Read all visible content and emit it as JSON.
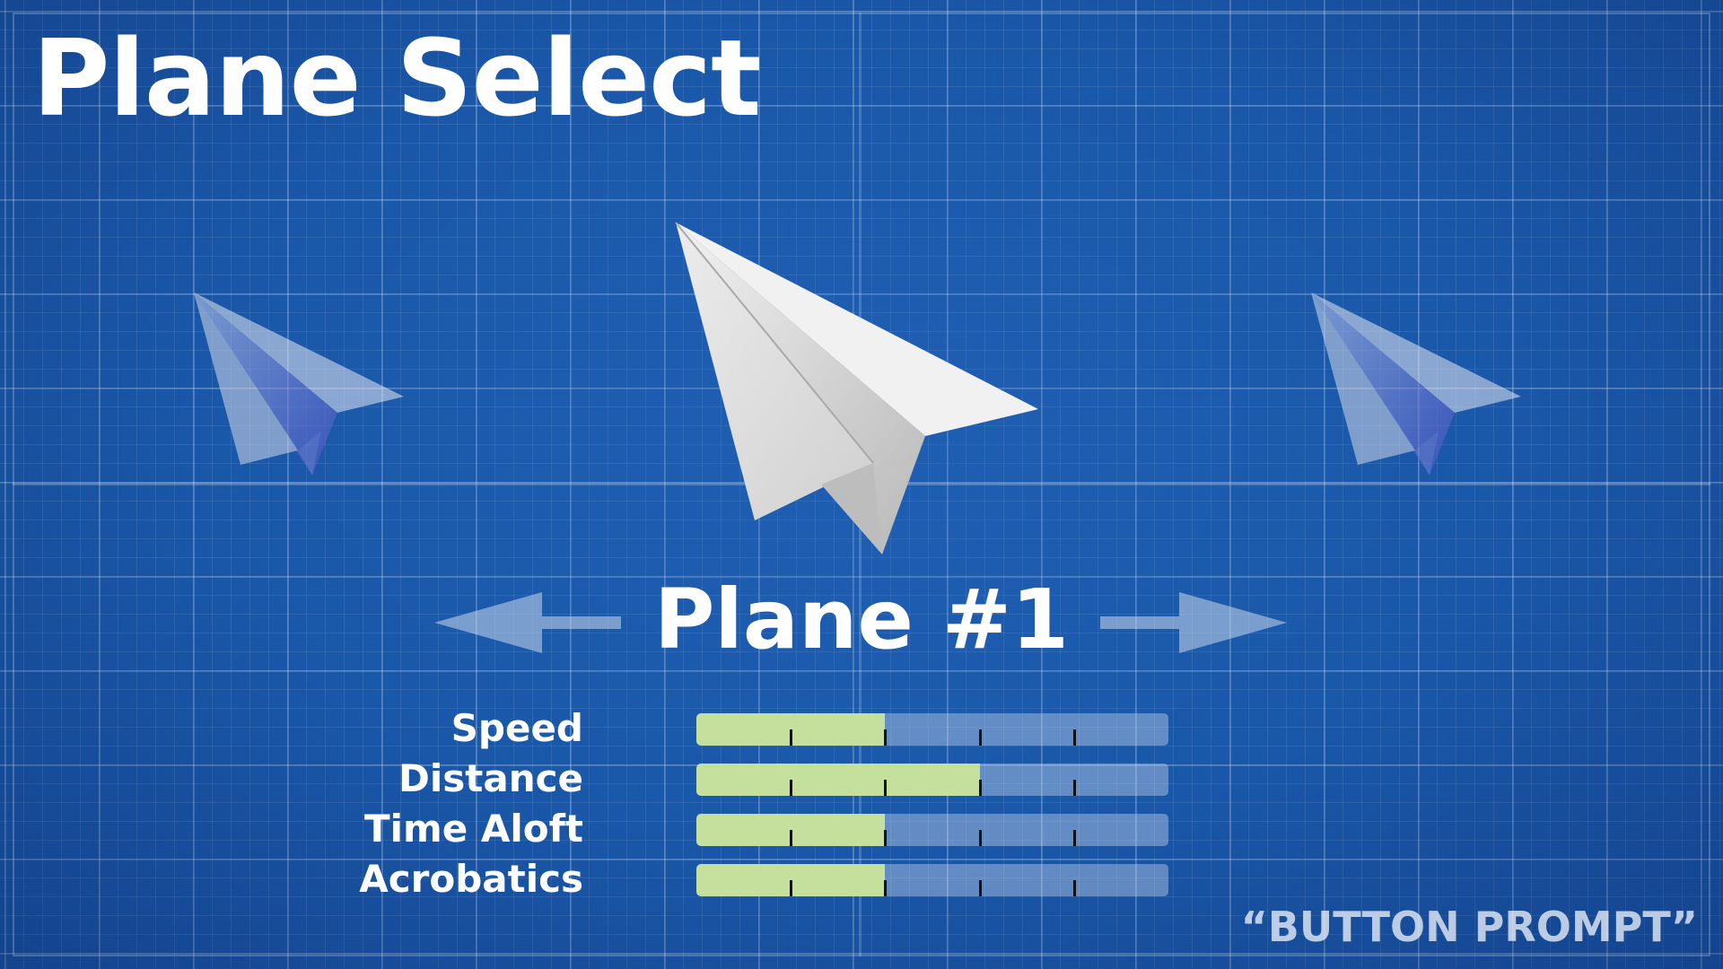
{
  "screen": {
    "title": "Plane Select",
    "background_color": "#1a57a8",
    "grid_color": "#ffffff"
  },
  "carousel": {
    "left_arrow_icon": "arrow-left-icon",
    "right_arrow_icon": "arrow-right-icon",
    "planes": [
      {
        "slot": "previous",
        "icon": "paper-plane-icon"
      },
      {
        "slot": "selected",
        "icon": "paper-plane-icon"
      },
      {
        "slot": "next",
        "icon": "paper-plane-icon"
      }
    ]
  },
  "selected_plane": {
    "name": "Plane #1"
  },
  "stats": {
    "max_level": 5,
    "fill_color": "#c5e09c",
    "items": [
      {
        "label": "Speed",
        "level": 2
      },
      {
        "label": "Distance",
        "level": 3
      },
      {
        "label": "Time Aloft",
        "level": 2
      },
      {
        "label": "Acrobatics",
        "level": 2
      }
    ]
  },
  "prompt": {
    "text": "“BUTTON PROMPT”"
  }
}
